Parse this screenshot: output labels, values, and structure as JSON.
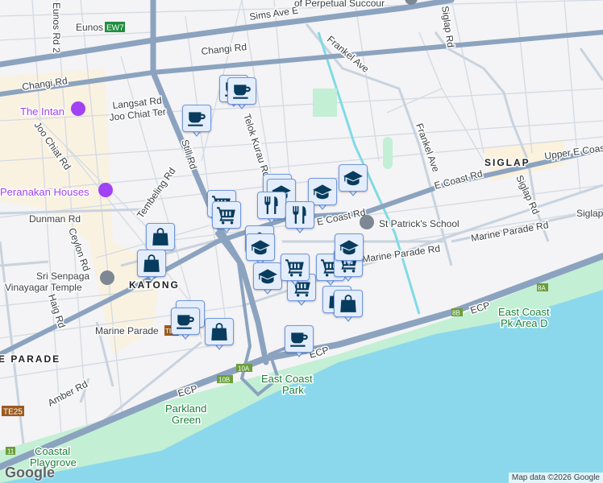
{
  "map": {
    "roads": [
      "Sims Ave E",
      "Changi Rd",
      "Changi Rd",
      "Eunos Rd 2",
      "Langsat Rd",
      "Joo Chiat Ter",
      "Joo Chiat Rd",
      "Still Rd",
      "Telok Kurau Rd",
      "Dunman Rd",
      "Ceylon Rd",
      "Tembeling Rd",
      "Haig Rd",
      "Amber Rd",
      "Frankel Ave",
      "Frankel Ave",
      "Siglap Rd",
      "Siglap Rd",
      "E Coast Rd",
      "E Coast Rd",
      "Upper E Coast",
      "Marine Parade Rd",
      "Marine Parade Rd",
      "Siglap",
      "ECP",
      "ECP",
      "ECP"
    ],
    "places": {
      "eunos": "Eunos",
      "eunos_station": "EW7",
      "church": "of Perpetual Succour",
      "intan": "The Intan",
      "peranakan": "Peranakan Houses",
      "temple_line1": "Sri Senpaga",
      "temple_line2": "Vinayagar Temple",
      "school": "St Patrick's School",
      "marine_parade": "Marine Parade",
      "marine_parade_station": "TE26",
      "te25": "TE25"
    },
    "areas": {
      "katong": "KATONG",
      "siglap": "SIGLAP",
      "parade": "E PARADE"
    },
    "parks": {
      "east_coast_park_1": "East Coast",
      "east_coast_park_2": "Park",
      "parkland_1": "Parkland",
      "parkland_2": "Green",
      "coastal_1": "Coastal",
      "coastal_2": "Playgrove",
      "area_d_1": "East Coast",
      "area_d_2": "Pk Area D"
    },
    "exits": [
      "10A",
      "10B",
      "8B",
      "8A",
      "11"
    ],
    "markers": [
      "coffee",
      "coffee",
      "coffee",
      "shopping",
      "shopping",
      "coffee",
      "coffee",
      "shopping",
      "coffee",
      "cart",
      "cart",
      "education",
      "education",
      "education",
      "education",
      "restaurant",
      "restaurant",
      "education",
      "education",
      "education",
      "cart",
      "cart",
      "cart",
      "cart",
      "education",
      "shopping",
      "shopping"
    ],
    "colors": {
      "marker_bg": "#e4edfc",
      "marker_border": "#6f97dc",
      "marker_icon": "#083c5e",
      "water": "#8bd8ec",
      "park": "#c3efd5",
      "highway": "#8ba3bf"
    }
  },
  "logo": "Google",
  "attribution": "Map data ©2026 Google"
}
